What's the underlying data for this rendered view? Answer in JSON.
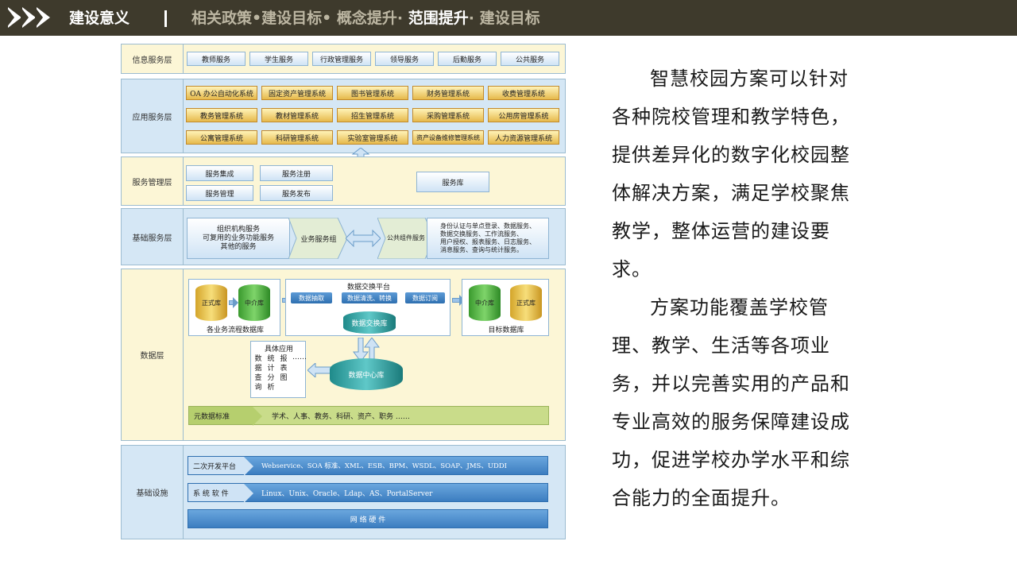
{
  "header": {
    "section_title": "建设意义",
    "nav_items": [
      {
        "label": "相关政策•",
        "active": false
      },
      {
        "label": "建设目标•",
        "active": false
      },
      {
        "label": "  概念提升·",
        "active": false
      },
      {
        "label": " 范围提升",
        "active": true
      },
      {
        "label": "·  建设目标",
        "active": false
      }
    ]
  },
  "diagram": {
    "info_layer": {
      "label": "信息服务层",
      "items": [
        "教师服务",
        "学生服务",
        "行政管理服务",
        "领导服务",
        "后勤服务",
        "公共服务"
      ]
    },
    "app_layer": {
      "label": "应用服务层",
      "rows": [
        [
          "OA 办公自动化系统",
          "固定资产管理系统",
          "图书管理系统",
          "财务管理系统",
          "收费管理系统"
        ],
        [
          "教务管理系统",
          "教材管理系统",
          "招生管理系统",
          "采购管理系统",
          "公用房管理系统"
        ],
        [
          "公寓管理系统",
          "科研管理系统",
          "实验室管理系统",
          "资产设备维修管理系统",
          "人力资源管理系统"
        ]
      ]
    },
    "svc_mgmt_layer": {
      "label": "服务管理层",
      "items": [
        "服务集成",
        "服务注册",
        "服务管理",
        "服务发布"
      ],
      "library": "服务库"
    },
    "base_svc_layer": {
      "label": "基础服务层",
      "org_box": "组织机构服务\n可复用的业务功能服务\n其他的服务",
      "biz_group": "业务服务组",
      "common_group": "公共组件服务",
      "common_detail": "身份认证与单点登录、数据服务、\n数据交换服务、工作流服务、\n用户授权、报表服务、日志服务、\n消息服务、查询与统计服务。"
    },
    "data_layer": {
      "label": "数据层",
      "left_db": {
        "formal": "正式库",
        "mid": "中介库",
        "caption": "各业务流程数据库"
      },
      "exchange": {
        "title": "数据交换平台",
        "steps": [
          "数据抽取",
          "数据清洗、转换",
          "数据订阅"
        ],
        "db": "数据交换库"
      },
      "right_db": {
        "mid": "中介库",
        "formal": "正式库",
        "caption": "目标数据库"
      },
      "apps": {
        "title": "具体应用",
        "cols": [
          "数据查询",
          "统计分析",
          "报表图",
          "……"
        ]
      },
      "center": "数据中心库",
      "meta": {
        "label": "元数据标准",
        "content": "学术、人事、教务、科研、资产、职务 ……"
      }
    },
    "infra_layer": {
      "label": "基础设施",
      "rows": [
        {
          "label": "二次开发平台",
          "content": "Webservice、SOA 标准、XML、ESB、BPM、WSDL、SOAP、JMS、UDDI"
        },
        {
          "label": "系 统 软 件",
          "content": "Linux、Unix、Oracle、Ldap、AS、PortalServer"
        }
      ],
      "network": "网 络 硬 件"
    }
  },
  "body": {
    "paragraphs": [
      "智慧校园方案可以针对各种院校管理和教学特色，提供差异化的数字化校园整体解决方案，满足学校聚焦教学，整体运营的建设要求。",
      "方案功能覆盖学校管理、教学、生活等各项业务，并以完善实用的产品和专业高效的服务保障建设成功，促进学校办学水平和综合能力的全面提升。"
    ]
  },
  "colors": {
    "header_bg": "#3e3a2c",
    "nav_inactive": "#bcb6a2",
    "cream": "#fcf6d6",
    "light_blue": "#d5e7f5",
    "gold": "#e6b94b"
  }
}
